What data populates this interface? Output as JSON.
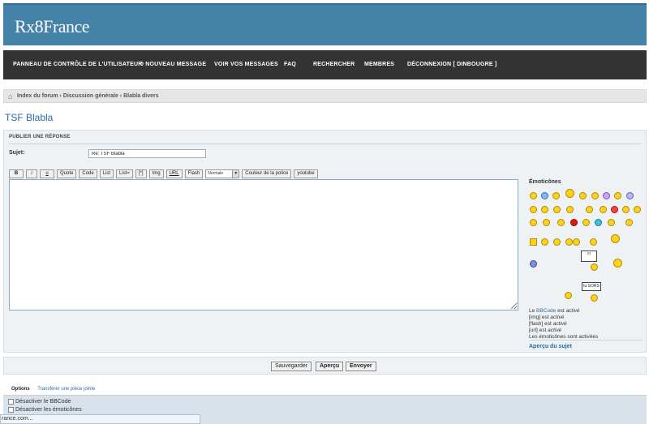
{
  "site": {
    "logo": "Rx8France"
  },
  "nav": [
    {
      "label": "PANNEAU DE CONTRÔLE DE L'UTILISATEUR"
    },
    {
      "label": "0 NOUVEAU MESSAGE"
    },
    {
      "label": "VOIR VOS MESSAGES"
    },
    {
      "label": "FAQ"
    },
    {
      "label": "RECHERCHER"
    },
    {
      "label": "MEMBRES"
    },
    {
      "label": "DÉCONNEXION [ DINBOUGRE ]"
    }
  ],
  "breadcrumb": {
    "home_icon": "home-icon",
    "trail": "Index du forum ‹ Discussion générale ‹ Blabla divers"
  },
  "topic": {
    "title": "TSF Blabla"
  },
  "form": {
    "heading": "PUBLIER UNE RÉPONSE",
    "subject_label": "Sujet:",
    "subject_value": "Re: TSF Blabla"
  },
  "toolbar": {
    "bold": "B",
    "italic": "i",
    "underline": "u",
    "quote": "Quote",
    "code": "Code",
    "list": "List",
    "list_eq": "List=",
    "list_item": "[*]",
    "img": "Img",
    "url": "URL",
    "flash": "Flash",
    "size_select": "Normale",
    "font_color": "Couleur de la police",
    "youtube": "youtube"
  },
  "emoticons": {
    "title": "Émoticônes",
    "sign1": "!!!",
    "sign2": "tu SORS"
  },
  "bbinfo": {
    "bbcode_link": "BBCode",
    "line1_pre": "Le ",
    "line1_post": " est ",
    "line1_state": "activé",
    "img_pre": "[img] est ",
    "img_state": "activé",
    "flash_pre": "[flash] est ",
    "flash_state": "activé",
    "url_pre": "[url] est ",
    "url_state": "activé",
    "emo_line": "Les émoticônes sont activées"
  },
  "preview_link": "Aperçu du sujet",
  "actions": {
    "save": "Sauvegarder",
    "preview": "Aperçu",
    "submit": "Envoyer"
  },
  "tabs": {
    "options": "Options",
    "attach": "Transférer une pièce jointe"
  },
  "options": {
    "disable_bbcode": "Désactiver le BBCode",
    "disable_smilies": "Désactiver les émoticônes"
  },
  "status_bar": "rance.com..."
}
